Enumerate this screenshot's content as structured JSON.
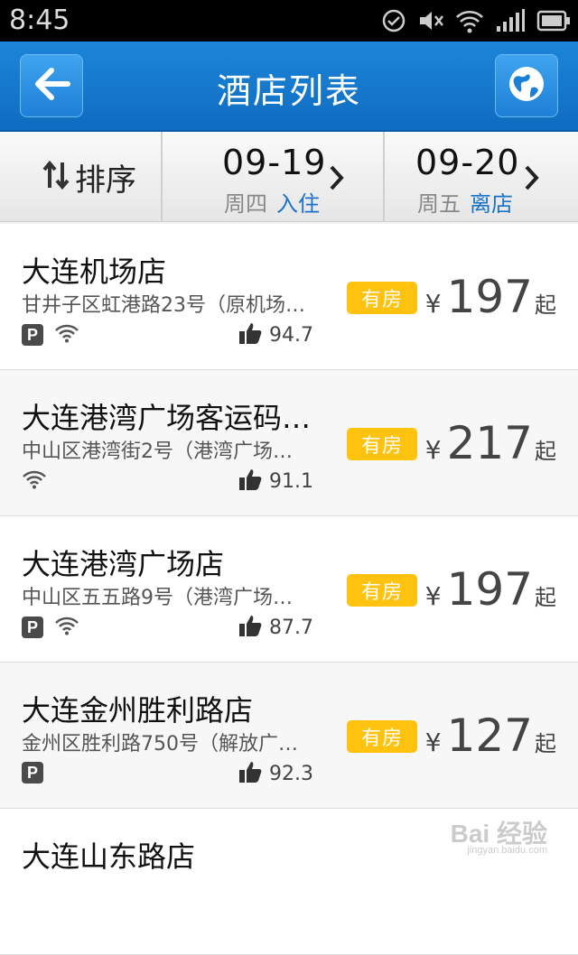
{
  "status": {
    "time": "8:45"
  },
  "header": {
    "title": "酒店列表"
  },
  "filter": {
    "sort_label": "排序",
    "checkin": {
      "date": "09-19",
      "weekday": "周四",
      "label": "入住"
    },
    "checkout": {
      "date": "09-20",
      "weekday": "周五",
      "label": "离店"
    }
  },
  "hotels": [
    {
      "name": "大连机场店",
      "address": "甘井子区虹港路23号（原机场…",
      "parking": true,
      "wifi": true,
      "score": "94.7",
      "availability": "有房",
      "currency": "¥",
      "price": "197",
      "price_suffix": "起"
    },
    {
      "name": "大连港湾广场客运码…",
      "address": "中山区港湾街2号（港湾广场…",
      "parking": false,
      "wifi": true,
      "score": "91.1",
      "availability": "有房",
      "currency": "¥",
      "price": "217",
      "price_suffix": "起"
    },
    {
      "name": "大连港湾广场店",
      "address": "中山区五五路9号（港湾广场…",
      "parking": true,
      "wifi": true,
      "score": "87.7",
      "availability": "有房",
      "currency": "¥",
      "price": "197",
      "price_suffix": "起"
    },
    {
      "name": "大连金州胜利路店",
      "address": "金州区胜利路750号（解放广…",
      "parking": true,
      "wifi": false,
      "score": "92.3",
      "availability": "有房",
      "currency": "¥",
      "price": "127",
      "price_suffix": "起"
    },
    {
      "name": "大连山东路店"
    }
  ],
  "watermark": {
    "text": "Bai 经验",
    "sub": "jingyan.baidu.com"
  },
  "colors": {
    "header": "#1676cc",
    "accent": "#1a73c9",
    "available_badge": "#ffc20e"
  }
}
